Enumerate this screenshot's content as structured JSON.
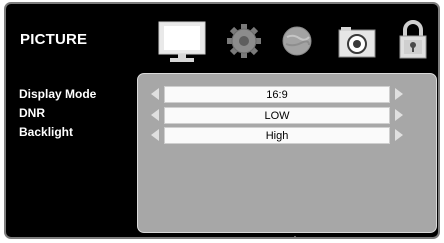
{
  "menu": {
    "title": "PICTURE"
  },
  "tabs": [
    {
      "icon": "monitor-icon",
      "selected": true
    },
    {
      "icon": "gear-icon",
      "selected": false
    },
    {
      "icon": "globe-icon",
      "selected": false
    },
    {
      "icon": "camera-icon",
      "selected": false
    },
    {
      "icon": "lock-icon",
      "selected": false
    }
  ],
  "settings": [
    {
      "label": "Display Mode",
      "value": "16:9"
    },
    {
      "label": "DNR",
      "value": "LOW"
    },
    {
      "label": "Backlight",
      "value": "High"
    }
  ],
  "colors": {
    "background": "#000000",
    "panel": "#a7a7a7",
    "text": "#ffffff"
  }
}
